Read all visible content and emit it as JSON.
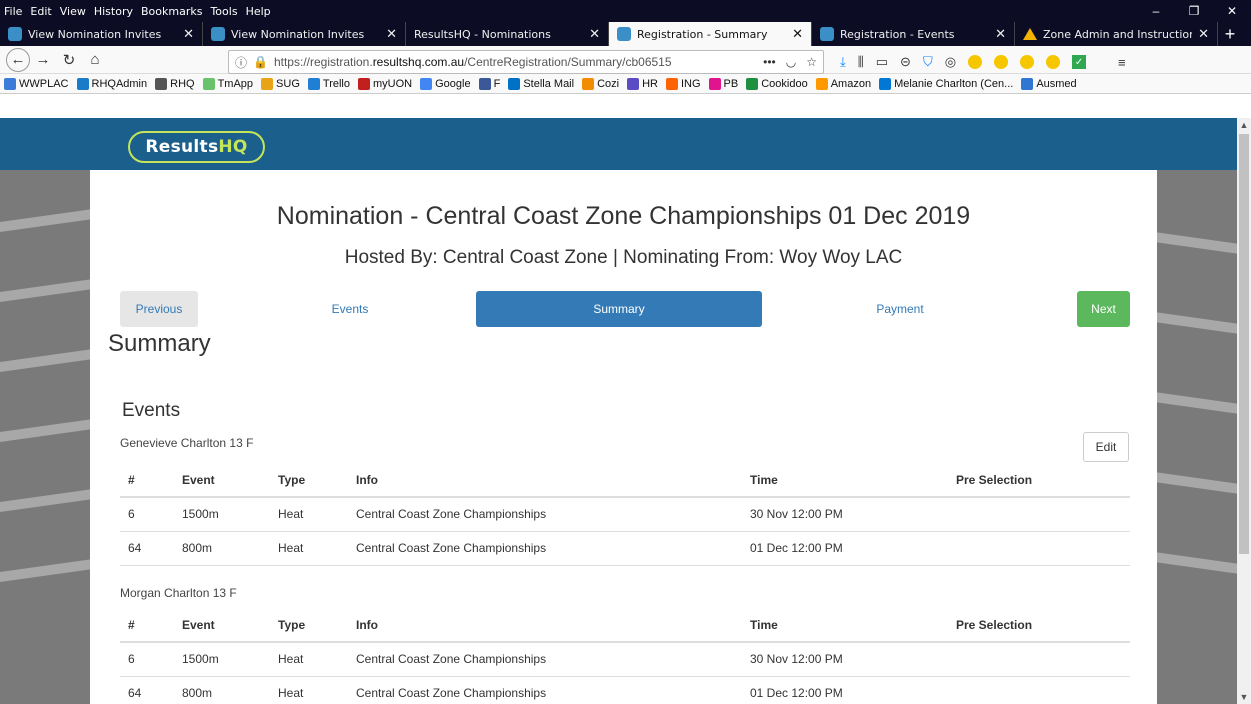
{
  "menubar": [
    "File",
    "Edit",
    "View",
    "History",
    "Bookmarks",
    "Tools",
    "Help"
  ],
  "window_controls": {
    "minimize": "–",
    "restore": "❐",
    "close": "✕"
  },
  "tabs": [
    {
      "label": "View Nomination Invites",
      "active": false
    },
    {
      "label": "View Nomination Invites",
      "active": false
    },
    {
      "label": "ResultsHQ - Nominations",
      "active": false
    },
    {
      "label": "Registration - Summary",
      "active": true
    },
    {
      "label": "Registration - Events",
      "active": false
    },
    {
      "label": "Zone Admin and Instructions -",
      "active": false
    }
  ],
  "url": {
    "prefix": "https://registration.",
    "domain": "resultshq.com.au",
    "path": "/CentreRegistration/Summary/cb06515"
  },
  "bookmarks": [
    "WWPLAC",
    "RHQAdmin",
    "RHQ",
    "TmApp",
    "SUG",
    "Trello",
    "myUON",
    "Google",
    "F",
    "Stella Mail",
    "Cozi",
    "HR",
    "ING",
    "PB",
    "Cookidoo",
    "Amazon",
    "Melanie Charlton (Cen...",
    "Ausmed"
  ],
  "site": {
    "logo_main": "Results",
    "logo_accent": "HQ"
  },
  "page": {
    "title": "Nomination - Central Coast Zone Championships 01 Dec 2019",
    "subtitle": "Hosted By: Central Coast Zone | Nominating From: Woy Woy LAC",
    "steps": {
      "previous": "Previous",
      "events": "Events",
      "summary": "Summary",
      "payment": "Payment",
      "next": "Next"
    },
    "summary_heading": "Summary",
    "events_heading": "Events",
    "edit_label": "Edit",
    "columns": [
      "#",
      "Event",
      "Type",
      "Info",
      "Time",
      "Pre Selection"
    ],
    "athletes": [
      {
        "name": "Genevieve Charlton 13 F",
        "rows": [
          [
            "6",
            "1500m",
            "Heat",
            "Central Coast Zone Championships",
            "30 Nov 12:00 PM",
            ""
          ],
          [
            "64",
            "800m",
            "Heat",
            "Central Coast Zone Championships",
            "01 Dec 12:00 PM",
            ""
          ]
        ]
      },
      {
        "name": "Morgan Charlton 13 F",
        "rows": [
          [
            "6",
            "1500m",
            "Heat",
            "Central Coast Zone Championships",
            "30 Nov 12:00 PM",
            ""
          ],
          [
            "64",
            "800m",
            "Heat",
            "Central Coast Zone Championships",
            "01 Dec 12:00 PM",
            ""
          ]
        ]
      }
    ]
  },
  "colors": {
    "banner": "#1b5f8c",
    "accent": "#c4e45a",
    "primary": "#337ab7",
    "next": "#5cb85c"
  }
}
